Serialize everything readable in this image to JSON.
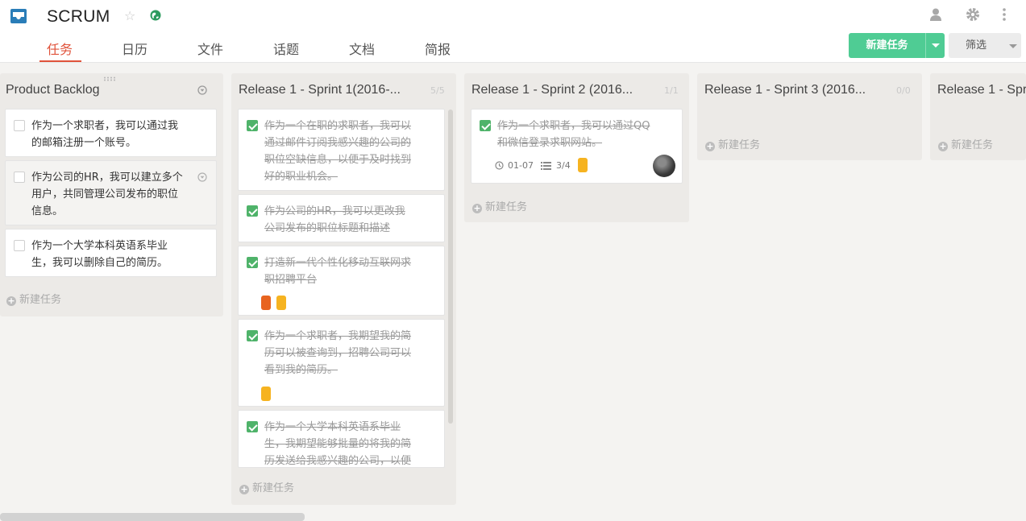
{
  "project": {
    "title": "SCRUM",
    "star_icon": "star-icon",
    "globe_icon": "globe-icon"
  },
  "tabs": [
    {
      "label": "任务",
      "active": true
    },
    {
      "label": "日历"
    },
    {
      "label": "文件"
    },
    {
      "label": "话题"
    },
    {
      "label": "文档"
    },
    {
      "label": "简报"
    }
  ],
  "header_actions": {
    "new_task": "新建任务",
    "filter": "筛选"
  },
  "add_task_label": "新建任务",
  "colors": {
    "accent": "#e0533b",
    "primary": "#4fcc94",
    "done_check": "#4fb36a",
    "tag_red": "#e8641f",
    "tag_yellow": "#f6b320"
  },
  "columns": [
    {
      "title": "Product Backlog",
      "cards": [
        {
          "text_lines": [
            "作为一个求职者，我可以通过我",
            "的邮箱注册一个账号。"
          ],
          "done": false
        },
        {
          "text_lines": [
            "作为公司的HR，我可以建立多个",
            "用户，共同管理公司发布的职位",
            "信息。"
          ],
          "done": false
        },
        {
          "text_lines": [
            "作为一个大学本科英语系毕业",
            "生，我可以删除自己的简历。"
          ],
          "done": false
        }
      ]
    },
    {
      "title": "Release 1 - Sprint 1(2016-...",
      "count": "5/5",
      "cards": [
        {
          "text_lines": [
            "作为一个在职的求职者，我可以",
            "通过邮件订阅我感兴趣的公司的",
            "职位空缺信息，以便于及时找到",
            "好的职业机会。"
          ],
          "done": true
        },
        {
          "text_lines": [
            "作为公司的HR，我可以更改我",
            "公司发布的职位标题和描述"
          ],
          "done": true
        },
        {
          "text_lines": [
            "打造新一代个性化移动互联网求",
            "职招聘平台"
          ],
          "done": true,
          "tags": [
            "red",
            "yellow"
          ]
        },
        {
          "text_lines": [
            "作为一个求职者，我期望我的简",
            "历可以被查询到，招聘公司可以",
            "看到我的简历。"
          ],
          "done": true,
          "tags": [
            "yellow"
          ]
        },
        {
          "text_lines": [
            "作为一个大学本科英语系毕业",
            "生，我期望能够批量的将我的简",
            "历发送给我感兴趣的公司，以便"
          ],
          "done": true
        }
      ]
    },
    {
      "title": "Release 1 - Sprint 2 (2016...",
      "count": "1/1",
      "cards": [
        {
          "text_lines": [
            "作为一个求职者，我可以通过QQ",
            "和微信登录求职网站。"
          ],
          "done": true,
          "due": "01-07",
          "subtasks": "3/4",
          "tags": [
            "yellow"
          ]
        }
      ]
    },
    {
      "title": "Release 1 - Sprint 3 (2016...",
      "count": "0/0",
      "cards": []
    },
    {
      "title": "Release 1 - Spr",
      "cards": []
    }
  ]
}
